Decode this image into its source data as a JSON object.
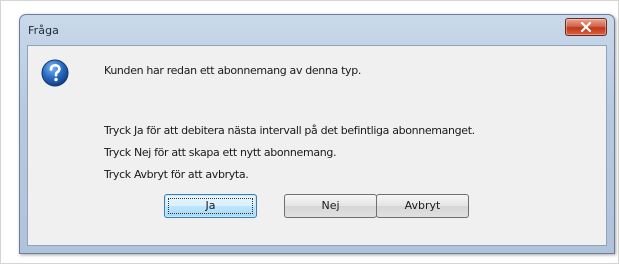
{
  "dialog": {
    "title": "Fråga",
    "icon": "question-icon",
    "message": "Kunden har redan ett abonnemang av denna typ.",
    "instructions": [
      "Tryck Ja för att debitera nästa intervall på det befintliga abonnemanget.",
      "Tryck Nej för att skapa ett nytt abonnemang.",
      "Tryck Avbryt för att avbryta."
    ],
    "buttons": {
      "yes": "Ja",
      "no": "Nej",
      "cancel": "Avbryt"
    },
    "close_icon": "close-icon"
  },
  "colors": {
    "close_button": "#c1371b",
    "question_icon": "#1f5fb4",
    "client_bg": "#f0f0f0",
    "default_button_border": "#3c7fb1"
  }
}
